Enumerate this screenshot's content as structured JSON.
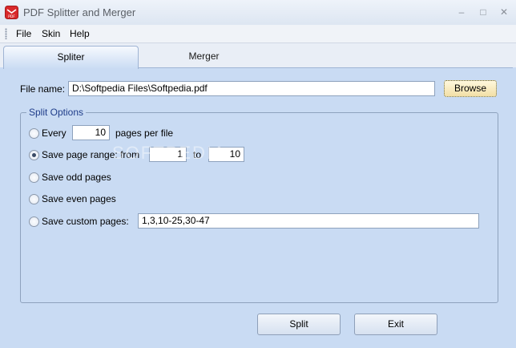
{
  "window": {
    "title": "PDF Splitter and Merger",
    "icon_label": "PDF",
    "minimize": "–",
    "maximize": "□",
    "close": "✕"
  },
  "menu": {
    "file": "File",
    "skin": "Skin",
    "help": "Help"
  },
  "tabs": {
    "spliter": "Spliter",
    "merger": "Merger"
  },
  "file": {
    "label": "File name:",
    "value": "D:\\Softpedia Files\\Softpedia.pdf",
    "browse": "Browse"
  },
  "split_options": {
    "legend": "Split Options",
    "every_label": "Every",
    "every_value": "10",
    "pages_per_file": "pages per file",
    "range_label": "Save page range: from",
    "range_from": "1",
    "range_to_label": "to",
    "range_to": "10",
    "odd_label": "Save odd pages",
    "even_label": "Save even pages",
    "custom_label": "Save custom pages:",
    "custom_value": "1,3,10-25,30-47",
    "selected": "range"
  },
  "actions": {
    "split": "Split",
    "exit": "Exit"
  },
  "watermark": "SOFTPEDIA",
  "colors": {
    "panel": "#c9dbf3",
    "accent_legend": "#1f3d8a",
    "browse_bg": "#f2dfa6"
  }
}
